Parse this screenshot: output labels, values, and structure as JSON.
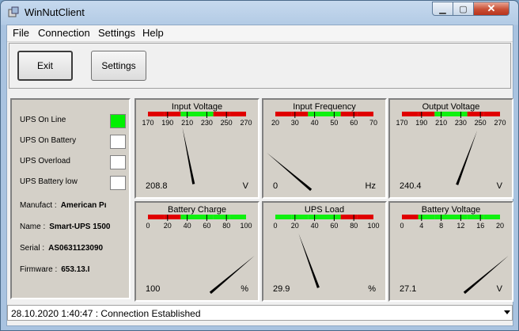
{
  "window": {
    "title": "WinNutClient"
  },
  "menu": [
    "File",
    "Connection",
    "Settings",
    "Help"
  ],
  "toolbar": {
    "exit_label": "Exit",
    "settings_label": "Settings"
  },
  "indicators": [
    {
      "label": "UPS On Line",
      "on": true
    },
    {
      "label": "UPS On Battery",
      "on": false
    },
    {
      "label": "UPS Overload",
      "on": false
    },
    {
      "label": "UPS Battery low",
      "on": false
    }
  ],
  "info": [
    {
      "label": "Manufact :",
      "value": "American Pı"
    },
    {
      "label": "Name :",
      "value": "Smart-UPS 1500"
    },
    {
      "label": "Serial :",
      "value": "AS0631123090"
    },
    {
      "label": "Firmware :",
      "value": "653.13.I"
    }
  ],
  "gauges": [
    {
      "name": "input-voltage",
      "title": "Input Voltage",
      "min": 170,
      "max": 270,
      "ticks": [
        "170",
        "190",
        "210",
        "230",
        "250",
        "270"
      ],
      "value": 208.8,
      "value_text": "208.8",
      "unit": "V",
      "bands": [
        "red",
        "red",
        "green",
        "green",
        "red",
        "red"
      ]
    },
    {
      "name": "input-frequency",
      "title": "Input Frequency",
      "min": 20,
      "max": 70,
      "ticks": [
        "20",
        "30",
        "40",
        "50",
        "60",
        "70"
      ],
      "value": 0,
      "value_text": "0",
      "unit": "Hz",
      "bands": [
        "red",
        "red",
        "green",
        "green",
        "red",
        "red"
      ]
    },
    {
      "name": "output-voltage",
      "title": "Output Voltage",
      "min": 170,
      "max": 270,
      "ticks": [
        "170",
        "190",
        "210",
        "230",
        "250",
        "270"
      ],
      "value": 240.4,
      "value_text": "240.4",
      "unit": "V",
      "bands": [
        "red",
        "red",
        "green",
        "green",
        "red",
        "red"
      ]
    },
    {
      "name": "battery-charge",
      "title": "Battery Charge",
      "min": 0,
      "max": 100,
      "ticks": [
        "0",
        "20",
        "40",
        "60",
        "80",
        "100"
      ],
      "value": 100,
      "value_text": "100",
      "unit": "%",
      "bands": [
        "red",
        "red",
        "green",
        "green",
        "green",
        "green"
      ]
    },
    {
      "name": "ups-load",
      "title": "UPS Load",
      "min": 0,
      "max": 100,
      "ticks": [
        "0",
        "20",
        "40",
        "60",
        "80",
        "100"
      ],
      "value": 29.9,
      "value_text": "29.9",
      "unit": "%",
      "bands": [
        "green",
        "green",
        "green",
        "green",
        "red",
        "red"
      ]
    },
    {
      "name": "battery-voltage",
      "title": "Battery Voltage",
      "min": 0,
      "max": 20,
      "ticks": [
        "0",
        "4",
        "8",
        "12",
        "16",
        "20"
      ],
      "value": 27.1,
      "value_text": "27.1",
      "unit": "V",
      "bands": [
        "red",
        "green",
        "green",
        "green",
        "green",
        "green"
      ]
    }
  ],
  "colors": {
    "red": "#e00000",
    "green": "#10f010",
    "on_indicator": "#00f000"
  },
  "status_bar": {
    "text": "28.10.2020 1:40:47 : Connection Established"
  }
}
